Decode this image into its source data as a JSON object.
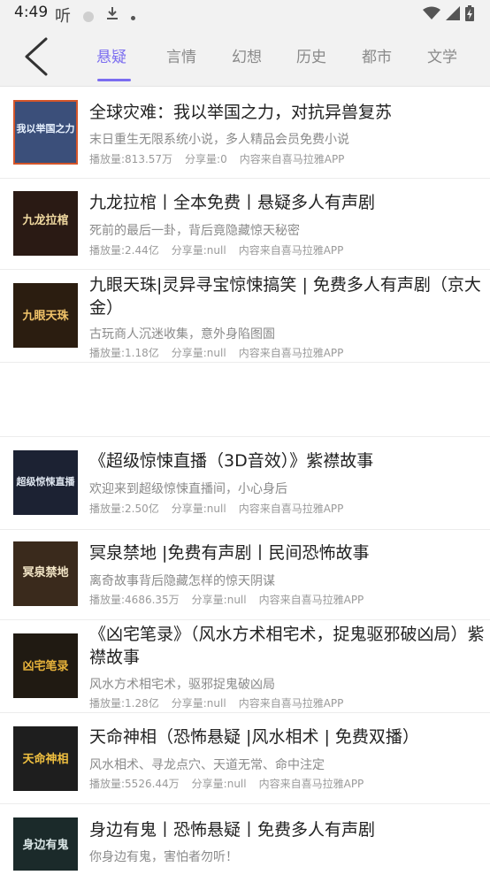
{
  "status_bar": {
    "time": "4:49",
    "icons_left": [
      "hear-icon",
      "record-dot-icon",
      "download-icon",
      "dot-icon"
    ],
    "icons_right": [
      "wifi-icon",
      "signal-icon",
      "battery-charging-icon"
    ],
    "hear_glyph": "听"
  },
  "nav": {
    "tabs": [
      "悬疑",
      "言情",
      "幻想",
      "历史",
      "都市",
      "文学"
    ],
    "active_tab": 0,
    "accent": "#7b6df0"
  },
  "items": [
    {
      "title": "全球灾难：我以举国之力，对抗异兽复苏",
      "desc": "末日重生无限系统小说，多人精品会员免费小说",
      "plays": "播放量:813.57万",
      "shares": "分享量:0",
      "source": "内容来自喜马拉雅APP",
      "cover_text": "我以举国之力",
      "cover_color": "#3b4f7a"
    },
    {
      "title": "九龙拉棺丨全本免费丨悬疑多人有声剧",
      "desc": "死前的最后一卦，背后竟隐藏惊天秘密",
      "plays": "播放量:2.44亿",
      "shares": "分享量:null",
      "source": "内容来自喜马拉雅APP",
      "cover_text": "九龙拉棺",
      "cover_color": "#2a1a14"
    },
    {
      "title": "九眼天珠|灵异寻宝惊悚搞笑 | 免费多人有声剧（京大金）",
      "desc": "古玩商人沉迷收集，意外身陷图圄",
      "plays": "播放量:1.18亿",
      "shares": "分享量:null",
      "source": "内容来自喜马拉雅APP",
      "cover_text": "九眼天珠",
      "cover_color": "#2b1d10"
    },
    {
      "title": "《超级惊悚直播（3D音效）》紫襟故事",
      "desc": "欢迎来到超级惊悚直播间，小心身后",
      "plays": "播放量:2.50亿",
      "shares": "分享量:null",
      "source": "内容来自喜马拉雅APP",
      "cover_text": "超级惊悚直播",
      "cover_color": "#1c2233"
    },
    {
      "title": "冥泉禁地 |免费有声剧丨民间恐怖故事",
      "desc": "离奇故事背后隐藏怎样的惊天阴谋",
      "plays": "播放量:4686.35万",
      "shares": "分享量:null",
      "source": "内容来自喜马拉雅APP",
      "cover_text": "冥泉禁地",
      "cover_color": "#3a2a1c"
    },
    {
      "title": "《凶宅笔录》（风水方术相宅术，捉鬼驱邪破凶局）紫襟故事",
      "desc": "风水方术相宅术，驱邪捉鬼破凶局",
      "plays": "播放量:1.28亿",
      "shares": "分享量:null",
      "source": "内容来自喜马拉雅APP",
      "cover_text": "凶宅笔录",
      "cover_color": "#201a12"
    },
    {
      "title": "天命神相（恐怖悬疑 |风水相术 | 免费双播）",
      "desc": "风水相术、寻龙点穴、天道无常、命中注定",
      "plays": "播放量:5526.44万",
      "shares": "分享量:null",
      "source": "内容来自喜马拉雅APP",
      "cover_text": "天命神相",
      "cover_color": "#1e1e1e"
    },
    {
      "title": "身边有鬼丨恐怖悬疑丨免费多人有声剧",
      "desc": "你身边有鬼，害怕者勿听！",
      "plays": "",
      "shares": "",
      "source": "",
      "cover_text": "身边有鬼",
      "cover_color": "#1b2a2a"
    }
  ]
}
